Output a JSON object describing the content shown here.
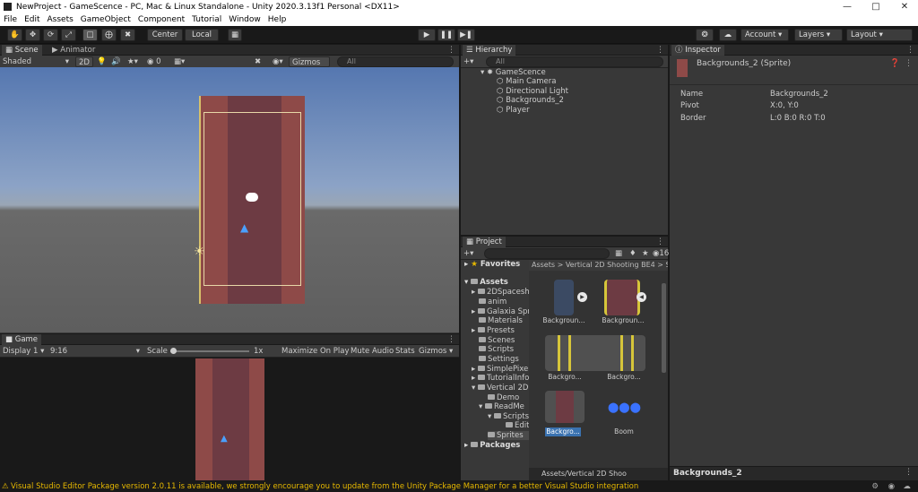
{
  "window": {
    "title": "NewProject - GameScence - PC, Mac & Linux Standalone - Unity 2020.3.13f1 Personal <DX11>"
  },
  "menu": [
    "File",
    "Edit",
    "Assets",
    "GameObject",
    "Component",
    "Tutorial",
    "Window",
    "Help"
  ],
  "toolbar": {
    "center_label": "Center",
    "local_label": "Local",
    "account_label": "Account",
    "layers_label": "Layers",
    "layout_label": "Layout"
  },
  "scene": {
    "tab_scene": "Scene",
    "tab_animator": "Animator",
    "shading": "Shaded",
    "mode_2d": "2D",
    "hidden_count": "0",
    "gizmos": "Gizmos",
    "search_placeholder": "All"
  },
  "game": {
    "tab": "Game",
    "display": "Display 1",
    "aspect": "9:16",
    "scale_label": "Scale",
    "scale_value": "1x",
    "maximize": "Maximize On Play",
    "mute": "Mute Audio",
    "stats": "Stats",
    "gizmos": "Gizmos"
  },
  "hierarchy": {
    "tab": "Hierarchy",
    "search_placeholder": "All",
    "scene_name": "GameScence",
    "items": [
      "Main Camera",
      "Directional Light",
      "Backgrounds_2",
      "Player"
    ]
  },
  "project": {
    "tab": "Project",
    "favorites": "Favorites",
    "assets": "Assets",
    "packages": "Packages",
    "badge_count": "16",
    "breadcrumb": "Assets  >  Vertical 2D Shooting BE4  >  S",
    "tree": [
      "2DSpacesh",
      "anim",
      "Galaxia Spr",
      "Materials",
      "Presets",
      "Scenes",
      "Scripts",
      "Settings",
      "SimplePixel",
      "TutorialInfo",
      "Vertical 2D",
      "Demo",
      "ReadMe",
      "Scripts",
      "Edit",
      "Sprites"
    ],
    "thumbs": [
      "Backgroun...",
      "Backgroun...",
      "Backgro...",
      "Backgro...",
      "Boom"
    ],
    "bottom_path": "Assets/Vertical 2D Shoo"
  },
  "inspector": {
    "tab": "Inspector",
    "header": "Backgrounds_2 (Sprite)",
    "fields": [
      {
        "label": "Name",
        "value": "Backgrounds_2"
      },
      {
        "label": "Pivot",
        "value": "X:0, Y:0"
      },
      {
        "label": "Border",
        "value": "L:0 B:0 R:0 T:0"
      }
    ],
    "footer": "Backgrounds_2"
  },
  "status": "Visual Studio Editor Package version 2.0.11 is available, we strongly encourage you to update from the Unity Package Manager for a better Visual Studio integration",
  "colors": {
    "accent": "#3a72b0",
    "warning": "#e6b800",
    "bg_sprite": "#6d3b43",
    "bg_sprite_edge": "#9a4a48"
  }
}
